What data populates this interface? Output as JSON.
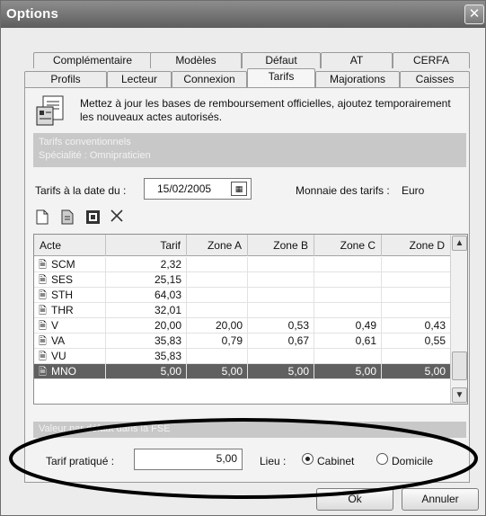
{
  "window": {
    "title": "Options",
    "close_glyph": "✕"
  },
  "tabs_row1": [
    {
      "label": "Complémentaire"
    },
    {
      "label": "Modèles"
    },
    {
      "label": "Défaut"
    },
    {
      "label": "AT"
    },
    {
      "label": "CERFA"
    }
  ],
  "tabs_row2": [
    {
      "label": "Profils"
    },
    {
      "label": "Lecteur"
    },
    {
      "label": "Connexion"
    },
    {
      "label": "Tarifs",
      "active": true
    },
    {
      "label": "Majorations"
    },
    {
      "label": "Caisses"
    }
  ],
  "info": {
    "text": "Mettez à jour les bases de remboursement officielles, ajoutez temporairement les nouveaux actes autorisés."
  },
  "section": {
    "line1": "Tarifs conventionnels",
    "line2": "Spécialité : Omnipraticien"
  },
  "date": {
    "label": "Tarifs à la date du :",
    "value": "15/02/2005"
  },
  "currency": {
    "label": "Monnaie des tarifs :",
    "value": "Euro"
  },
  "toolbar": {
    "icons": [
      "new-document-icon",
      "copy-document-icon",
      "edit-icon",
      "delete-icon"
    ]
  },
  "grid": {
    "columns": [
      "Acte",
      "Tarif",
      "Zone A",
      "Zone B",
      "Zone C",
      "Zone D"
    ],
    "rows": [
      {
        "acte": "SCM",
        "tarif": "2,32",
        "za": "",
        "zb": "",
        "zc": "",
        "zd": ""
      },
      {
        "acte": "SES",
        "tarif": "25,15",
        "za": "",
        "zb": "",
        "zc": "",
        "zd": ""
      },
      {
        "acte": "STH",
        "tarif": "64,03",
        "za": "",
        "zb": "",
        "zc": "",
        "zd": ""
      },
      {
        "acte": "THR",
        "tarif": "32,01",
        "za": "",
        "zb": "",
        "zc": "",
        "zd": ""
      },
      {
        "acte": "V",
        "tarif": "20,00",
        "za": "20,00",
        "zb": "0,53",
        "zc": "0,49",
        "zd": "0,43"
      },
      {
        "acte": "VA",
        "tarif": "35,83",
        "za": "0,79",
        "zb": "0,67",
        "zc": "0,61",
        "zd": "0,55"
      },
      {
        "acte": "VU",
        "tarif": "35,83",
        "za": "",
        "zb": "",
        "zc": "",
        "zd": ""
      },
      {
        "acte": "MNO",
        "tarif": "5,00",
        "za": "5,00",
        "zb": "5,00",
        "zc": "5,00",
        "zd": "5,00",
        "selected": true
      }
    ]
  },
  "fse": {
    "header": "Valeur par défaut dans la FSE",
    "tarif_label": "Tarif pratiqué :",
    "tarif_value": "5,00",
    "lieu_label": "Lieu :",
    "options": [
      {
        "label": "Cabinet",
        "checked": true
      },
      {
        "label": "Domicile",
        "checked": false
      }
    ]
  },
  "buttons": {
    "ok": "Ok",
    "cancel": "Annuler"
  }
}
